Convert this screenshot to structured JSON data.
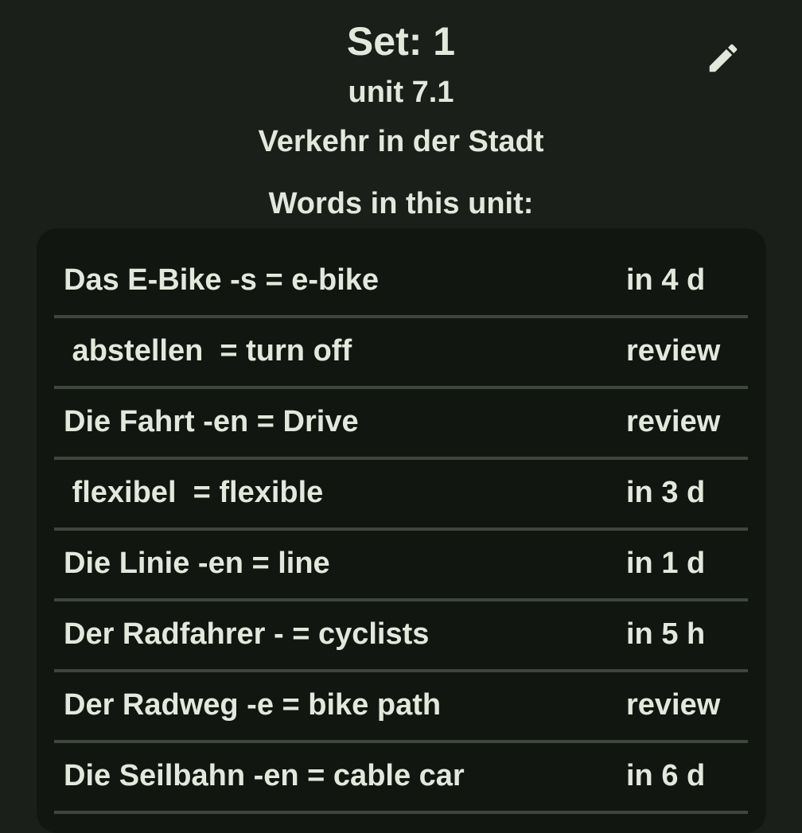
{
  "header": {
    "set_title": "Set: 1",
    "unit_name": "unit 7.1",
    "unit_topic": "Verkehr in der Stadt",
    "edit_icon": "pencil-icon"
  },
  "words_heading": "Words in this unit:",
  "words": [
    {
      "entry": "Das E-Bike -s = e-bike",
      "due": "in 4 d"
    },
    {
      "entry": " abstellen  = turn off",
      "due": "review"
    },
    {
      "entry": "Die Fahrt -en = Drive",
      "due": "review"
    },
    {
      "entry": " flexibel  = flexible",
      "due": "in 3 d"
    },
    {
      "entry": "Die Linie -en = line",
      "due": "in 1 d"
    },
    {
      "entry": "Der Radfahrer - = cyclists",
      "due": "in 5 h"
    },
    {
      "entry": "Der Radweg -e = bike path",
      "due": "review"
    },
    {
      "entry": "Die Seilbahn -en = cable car",
      "due": "in 6 d"
    }
  ],
  "colors": {
    "background": "#1b1f1a",
    "card": "#121611",
    "text": "#e3e8dc",
    "divider": "#3f463d"
  }
}
